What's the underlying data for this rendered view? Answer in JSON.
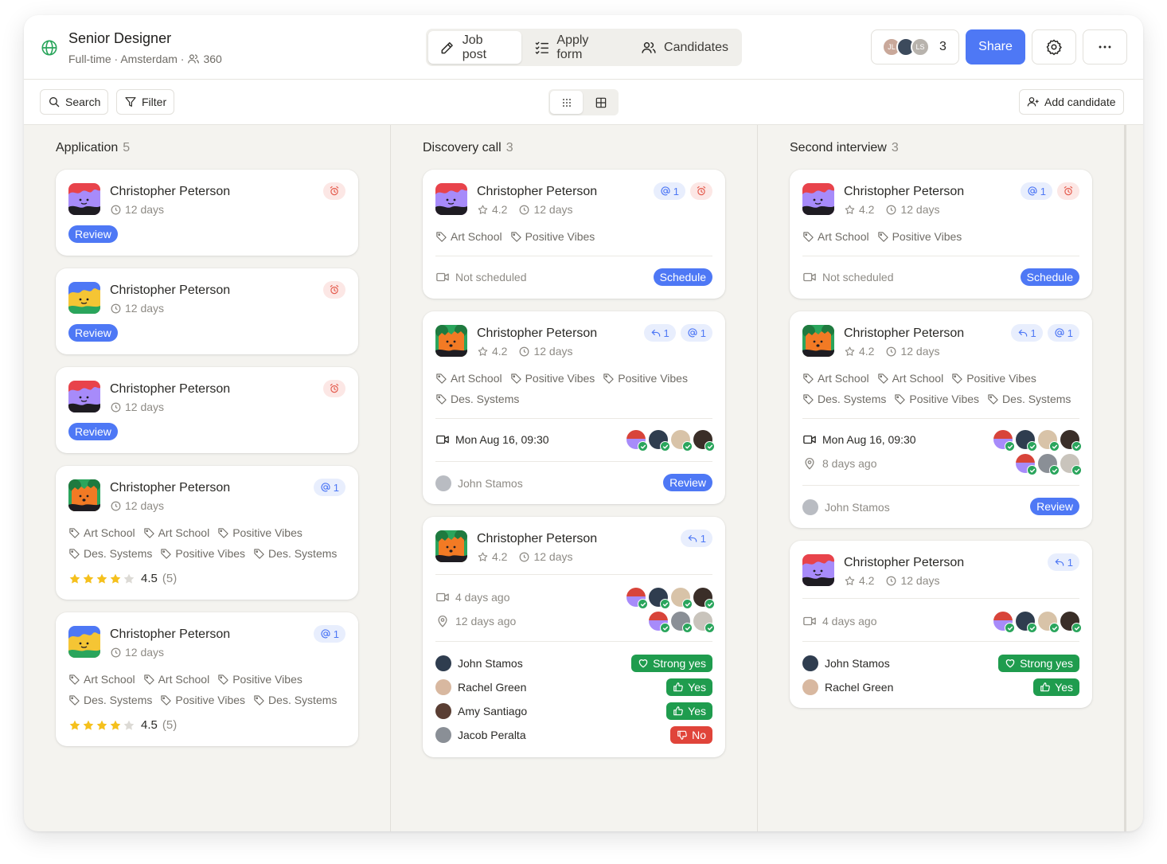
{
  "header": {
    "job_title": "Senior Designer",
    "job_meta": "Full-time · Amsterdam ·",
    "applicant_count": "360",
    "tabs": [
      "Job post",
      "Apply form",
      "Candidates"
    ],
    "active_tab": "Job post",
    "collaborators": [
      "JL",
      "",
      "LS"
    ],
    "collaborator_count": "3",
    "share_label": "Share"
  },
  "toolbar": {
    "search_label": "Search",
    "filter_label": "Filter",
    "add_candidate_label": "Add candidate"
  },
  "colors": {
    "accent": "#4e78f5",
    "positive": "#1f9c4e",
    "negative": "#e0443a",
    "alarm": "#e45a4c"
  },
  "columns": [
    {
      "title": "Application",
      "count": "5",
      "cards": [
        {
          "name": "Christopher Peterson",
          "days": "12 days",
          "status": "Review",
          "badges": [
            "alarm"
          ]
        },
        {
          "name": "Christopher Peterson",
          "days": "12 days",
          "status": "Review",
          "badges": [
            "alarm"
          ]
        },
        {
          "name": "Christopher Peterson",
          "days": "12 days",
          "status": "Review",
          "badges": [
            "alarm"
          ]
        },
        {
          "name": "Christopher Peterson",
          "days": "12 days",
          "mention_count": "1",
          "tags": [
            "Art School",
            "Art School",
            "Positive Vibes",
            "Des. Systems",
            "Positive Vibes",
            "Des. Systems"
          ],
          "rating": "4.5",
          "rating_count": "(5)",
          "stars": 4
        },
        {
          "name": "Christopher Peterson",
          "days": "12 days",
          "mention_count": "1",
          "tags": [
            "Art School",
            "Art School",
            "Positive Vibes",
            "Des. Systems",
            "Positive Vibes",
            "Des. Systems"
          ],
          "rating": "4.5",
          "rating_count": "(5)",
          "stars": 4
        }
      ]
    },
    {
      "title": "Discovery call",
      "count": "3",
      "cards": [
        {
          "name": "Christopher Peterson",
          "score": "4.2",
          "days": "12 days",
          "mention_count": "1",
          "tags": [
            "Art School",
            "Positive Vibes"
          ],
          "schedule": "Not scheduled",
          "schedule_button": "Schedule"
        },
        {
          "name": "Christopher Peterson",
          "score": "4.2",
          "days": "12 days",
          "reply_count": "1",
          "mention_count": "1",
          "tags": [
            "Art School",
            "Positive Vibes",
            "Positive Vibes",
            "Des. Systems"
          ],
          "meeting": "Mon Aug 16, 09:30",
          "owner": "John Stamos",
          "status": "Review"
        },
        {
          "name": "Christopher Peterson",
          "score": "4.2",
          "days": "12 days",
          "reply_count": "1",
          "meeting": "4 days ago",
          "location": "12 days ago",
          "reviews": [
            {
              "name": "John Stamos",
              "verdict": "Strong yes"
            },
            {
              "name": "Rachel Green",
              "verdict": "Yes"
            },
            {
              "name": "Amy Santiago",
              "verdict": "Yes"
            },
            {
              "name": "Jacob Peralta",
              "verdict": "No"
            }
          ]
        }
      ]
    },
    {
      "title": "Second interview",
      "count": "3",
      "cards": [
        {
          "name": "Christopher Peterson",
          "score": "4.2",
          "days": "12 days",
          "mention_count": "1",
          "tags": [
            "Art School",
            "Positive Vibes"
          ],
          "schedule": "Not scheduled",
          "schedule_button": "Schedule"
        },
        {
          "name": "Christopher Peterson",
          "score": "4.2",
          "days": "12 days",
          "reply_count": "1",
          "mention_count": "1",
          "tags": [
            "Art School",
            "Art School",
            "Positive Vibes",
            "Des. Systems",
            "Positive Vibes",
            "Des. Systems"
          ],
          "meeting": "Mon Aug 16, 09:30",
          "location": "8 days ago",
          "owner": "John Stamos",
          "status": "Review"
        },
        {
          "name": "Christopher Peterson",
          "score": "4.2",
          "days": "12 days",
          "reply_count": "1",
          "meeting": "4 days ago",
          "reviews": [
            {
              "name": "John Stamos",
              "verdict": "Strong yes"
            },
            {
              "name": "Rachel Green",
              "verdict": "Yes"
            }
          ]
        }
      ]
    }
  ]
}
